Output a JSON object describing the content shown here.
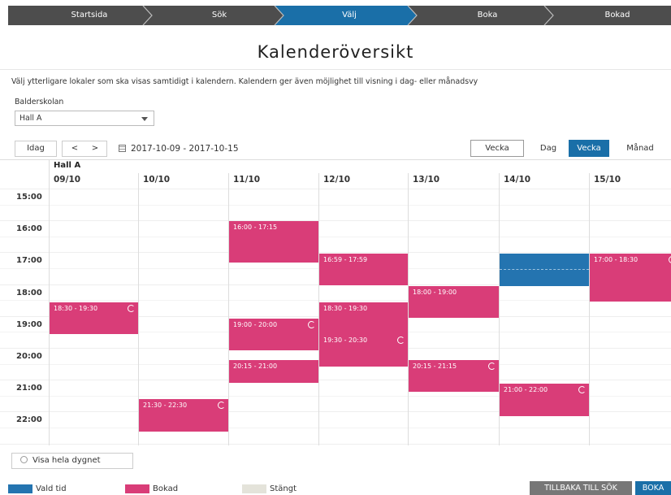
{
  "steps": [
    {
      "label": "Startsida"
    },
    {
      "label": "Sök"
    },
    {
      "label": "Välj"
    },
    {
      "label": "Boka"
    },
    {
      "label": "Bokad"
    }
  ],
  "active_step_index": 2,
  "title": "Kalenderöversikt",
  "description": "Välj ytterligare lokaler som ska visas samtidigt i kalendern. Kalendern ger även möjlighet till visning i dag- eller månadsvy",
  "school_label": "Balderskolan",
  "hall_select": {
    "value": "Hall A"
  },
  "toolbar": {
    "today": "Idag",
    "prev": "<",
    "next": ">",
    "range": "2017-10-09 - 2017-10-15"
  },
  "view_dropdown": "Vecka",
  "views": [
    {
      "label": "Dag",
      "active": false
    },
    {
      "label": "Vecka",
      "active": true
    },
    {
      "label": "Månad",
      "active": false
    }
  ],
  "hall_header": "Hall A",
  "days": [
    "09/10",
    "10/10",
    "11/10",
    "12/10",
    "13/10",
    "14/10",
    "15/10"
  ],
  "hours": [
    "15:00",
    "16:00",
    "17:00",
    "18:00",
    "19:00",
    "20:00",
    "21:00",
    "22:00"
  ],
  "events": [
    {
      "day": 0,
      "label": "18:30 - 19:30",
      "type": "bokad",
      "repeat": true
    },
    {
      "day": 1,
      "label": "21:30 - 22:30",
      "type": "bokad",
      "repeat": true
    },
    {
      "day": 2,
      "label": "16:00 - 17:15",
      "type": "bokad",
      "repeat": false
    },
    {
      "day": 2,
      "label": "19:00 - 20:00",
      "type": "bokad",
      "repeat": true
    },
    {
      "day": 2,
      "label": "20:15 - 21:00",
      "type": "bokad",
      "repeat": false
    },
    {
      "day": 3,
      "label": "16:59 - 17:59",
      "type": "bokad",
      "repeat": false
    },
    {
      "day": 3,
      "label": "18:30 - 19:30",
      "type": "bokad",
      "repeat": false
    },
    {
      "day": 3,
      "label": "19:30 - 20:30",
      "type": "bokad",
      "repeat": true
    },
    {
      "day": 4,
      "label": "18:00 - 19:00",
      "type": "bokad",
      "repeat": false
    },
    {
      "day": 4,
      "label": "20:15 - 21:15",
      "type": "bokad",
      "repeat": true
    },
    {
      "day": 5,
      "label": "",
      "type": "vald",
      "repeat": false
    },
    {
      "day": 5,
      "label": "21:00 - 22:00",
      "type": "bokad",
      "repeat": true
    },
    {
      "day": 6,
      "label": "17:00 - 18:30",
      "type": "bokad",
      "repeat": true
    }
  ],
  "show_full_day": "Visa hela dygnet",
  "legend": [
    {
      "label": "Vald tid",
      "color": "#2474b0"
    },
    {
      "label": "Bokad",
      "color": "#d93d78"
    },
    {
      "label": "Stängt",
      "color": "#e4e3da"
    }
  ],
  "buttons": {
    "back": "TILLBAKA TILL SÖK",
    "book": "BOKA"
  },
  "colors": {
    "step_bar": "#4d4d4d",
    "step_active": "#1a6fa8",
    "bokad": "#d93d78",
    "vald": "#2474b0"
  }
}
